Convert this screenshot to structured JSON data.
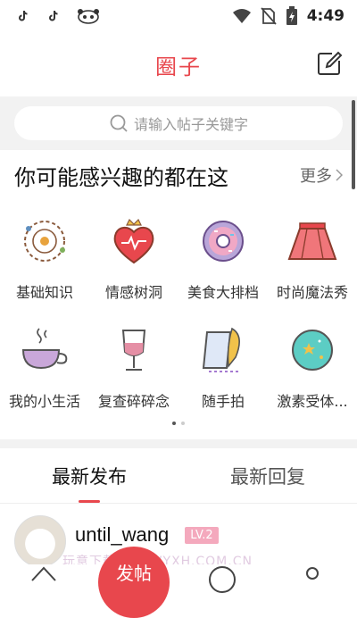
{
  "status_bar": {
    "time": "4:49"
  },
  "header": {
    "title": "圈子"
  },
  "search": {
    "placeholder": "请输入帖子关键字"
  },
  "section": {
    "title": "你可能感兴趣的都在这",
    "more_label": "更多"
  },
  "categories": [
    {
      "label": "基础知识",
      "icon": "solar-system-icon"
    },
    {
      "label": "情感树洞",
      "icon": "heart-crown-icon"
    },
    {
      "label": "美食大排档",
      "icon": "donut-icon"
    },
    {
      "label": "时尚魔法秀",
      "icon": "skirt-icon"
    },
    {
      "label": "我的小生活",
      "icon": "tea-cup-icon"
    },
    {
      "label": "复查碎碎念",
      "icon": "wine-glass-icon"
    },
    {
      "label": "随手拍",
      "icon": "paper-feather-icon"
    },
    {
      "label": "激素受体...",
      "icon": "star-planet-icon"
    }
  ],
  "tabs": [
    {
      "label": "最新发布",
      "active": true
    },
    {
      "label": "最新回复",
      "active": false
    }
  ],
  "post": {
    "username": "until_wang",
    "level": "LV.2"
  },
  "watermark": "玩意下载 · NEWYXH.COM.CN",
  "fab_label": "发帖",
  "colors": {
    "accent": "#e8474d",
    "level_badge": "#f4a9bd"
  }
}
